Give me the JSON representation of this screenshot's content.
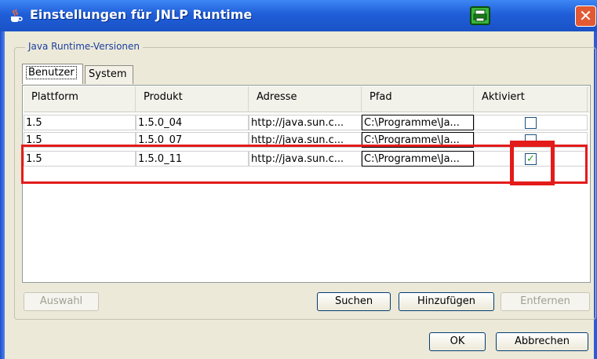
{
  "window": {
    "title": "Einstellungen für JNLP Runtime",
    "close_glyph": "✕"
  },
  "group": {
    "label": "Java Runtime-Versionen"
  },
  "tabs": [
    {
      "label": "Benutzer"
    },
    {
      "label": "System"
    }
  ],
  "table": {
    "columns": [
      "Plattform",
      "Produkt",
      "Adresse",
      "Pfad",
      "Aktiviert"
    ],
    "rows": [
      {
        "plattform": "1.5",
        "produkt": "1.5.0_04",
        "adresse": "http://java.sun.c...",
        "pfad": "C:\\Programme\\Ja...",
        "aktiviert": false
      },
      {
        "plattform": "1.5",
        "produkt": "1.5.0_07",
        "adresse": "http://java.sun.c...",
        "pfad": "C:\\Programme\\Ja...",
        "aktiviert": false
      },
      {
        "plattform": "1.5",
        "produkt": "1.5.0_11",
        "adresse": "http://java.sun.c...",
        "pfad": "C:\\Programme\\Ja...",
        "aktiviert": true
      }
    ]
  },
  "buttons": {
    "auswahl": "Auswahl",
    "suchen": "Suchen",
    "hinzufuegen": "Hinzufügen",
    "entfernen": "Entfernen",
    "ok": "OK",
    "abbrechen": "Abbrechen"
  },
  "colors": {
    "highlight": "#e41b1b",
    "titlebar": "#1f5ed8",
    "check": "#21a121"
  }
}
